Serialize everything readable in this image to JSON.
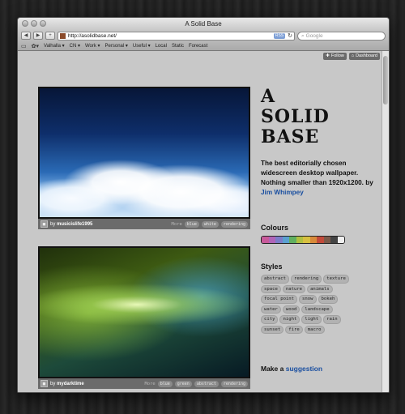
{
  "window": {
    "title": "A Solid Base"
  },
  "browser": {
    "url": "http://asolidbase.net/",
    "rss_label": "RSS",
    "search_placeholder": "Google",
    "bookmarks": [
      "Valhalla ▾",
      "CN ▾",
      "Work ▾",
      "Personal ▾",
      "Useful ▾",
      "Local",
      "Static",
      "Forecast"
    ]
  },
  "page": {
    "top_buttons": {
      "follow": "Follow",
      "dashboard": "Dashboard"
    },
    "logo_lines": [
      "A",
      "SOLID",
      "BASE"
    ],
    "blurb": "The best editorially chosen widescreen desktop wallpaper. Nothing smaller than 1920x1200. by ",
    "blurb_link": "Jim Whimpey",
    "colours_heading": "Colours",
    "colours": [
      "#c85a9a",
      "#b064b8",
      "#7c7cc8",
      "#5aa0d0",
      "#60b060",
      "#b0c040",
      "#d8c040",
      "#d88a3a",
      "#c24a3a",
      "#7a5a4a",
      "#444444",
      "#f0f0f0"
    ],
    "styles_heading": "Styles",
    "styles": [
      "abstract",
      "rendering",
      "texture",
      "space",
      "nature",
      "animals",
      "focal point",
      "snow",
      "bokeh",
      "water",
      "wood",
      "landscape",
      "city",
      "night",
      "light",
      "rain",
      "sunset",
      "fire",
      "macro"
    ],
    "suggest_text": "Make a ",
    "suggest_link": "suggestion"
  },
  "wallpapers": [
    {
      "author": "musicislife1995",
      "more": "More",
      "tags": [
        "blue",
        "white",
        "rendering"
      ]
    },
    {
      "author": "mydarktime",
      "more": "More",
      "tags": [
        "blue",
        "green",
        "abstract",
        "rendering"
      ]
    }
  ]
}
